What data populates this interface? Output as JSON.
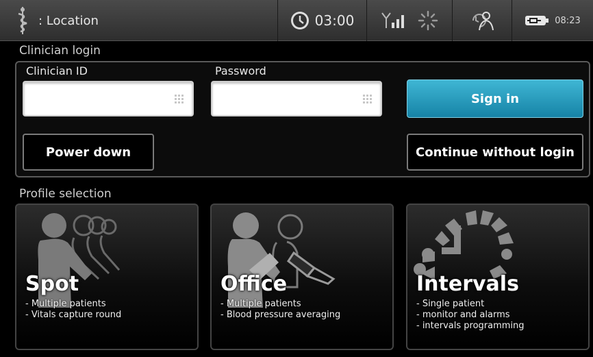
{
  "status_bar": {
    "location_label": ": Location",
    "timer": "03:00",
    "clock": "08:23",
    "icons": [
      "caduceus-icon",
      "timer-icon",
      "signal-icon",
      "connecting-icon",
      "user-icon",
      "battery-icon"
    ]
  },
  "login": {
    "section_title": "Clinician login",
    "clinician_id_label": "Clinician ID",
    "clinician_id_value": "",
    "password_label": "Password",
    "password_value": "",
    "sign_in": "Sign in",
    "power_down": "Power down",
    "continue_without_login": "Continue without login"
  },
  "profiles": {
    "section_title": "Profile selection",
    "cards": [
      {
        "title": "Spot",
        "lines": [
          "- Multiple patients",
          "- Vitals capture round"
        ]
      },
      {
        "title": "Office",
        "lines": [
          "- Multiple patients",
          "- Blood pressure averaging"
        ]
      },
      {
        "title": "Intervals",
        "lines": [
          "- Single patient",
          "- monitor and alarms",
          "- intervals programming"
        ]
      }
    ]
  },
  "colors": {
    "accent": "#1e93b8",
    "background": "#000000",
    "status_bar": "#3a3a3a"
  }
}
